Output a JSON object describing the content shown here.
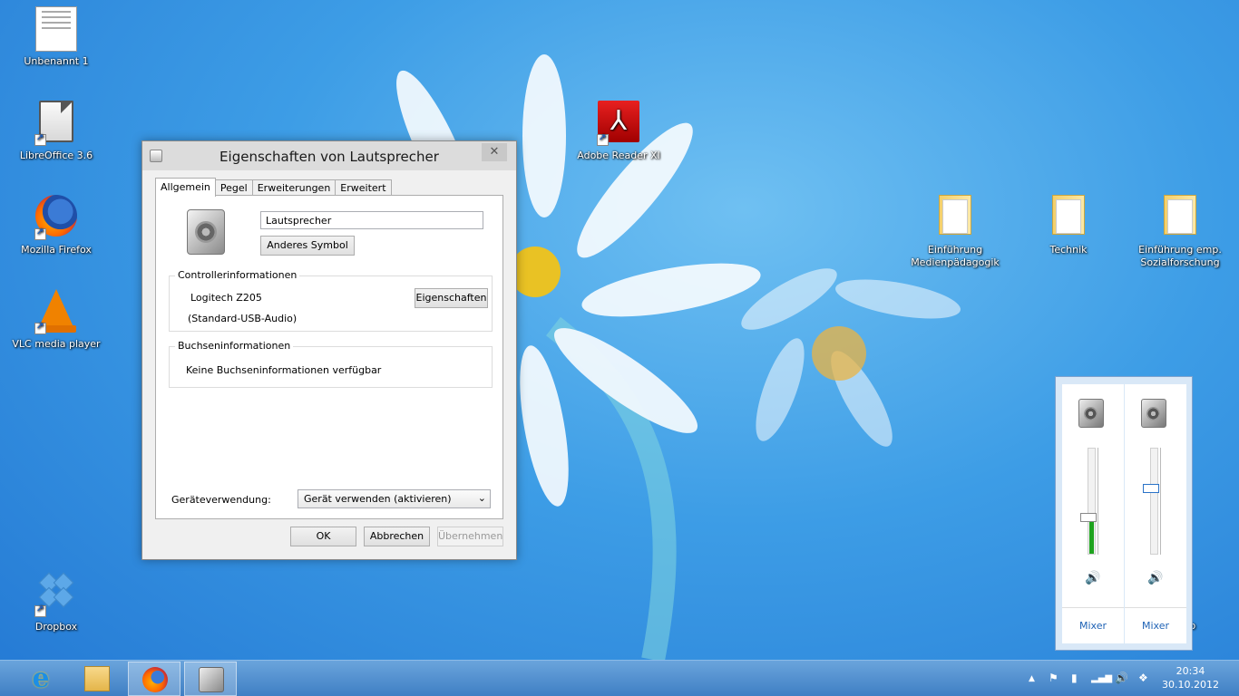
{
  "desktop": {
    "icons": [
      {
        "label": "Unbenannt 1",
        "icon": "document-icon"
      },
      {
        "label": "LibreOffice 3.6",
        "icon": "libreoffice-icon"
      },
      {
        "label": "Mozilla Firefox",
        "icon": "firefox-icon"
      },
      {
        "label": "VLC media player",
        "icon": "vlc-icon"
      },
      {
        "label": "Dropbox",
        "icon": "dropbox-icon"
      },
      {
        "label": "Adobe Reader XI",
        "icon": "adobe-reader-icon"
      },
      {
        "label": "Einführung Medienpädagogik",
        "icon": "folder-icon"
      },
      {
        "label": "Technik",
        "icon": "folder-icon"
      },
      {
        "label": "Einführung emp. Sozialforschung",
        "icon": "folder-icon"
      }
    ],
    "partial_label": "orb"
  },
  "dialog": {
    "title": "Eigenschaften von Lautsprecher",
    "close_glyph": "✕",
    "tabs": [
      "Allgemein",
      "Pegel",
      "Erweiterungen",
      "Erweitert"
    ],
    "active_tab": "Allgemein",
    "device_name": "Lautsprecher",
    "change_icon_button": "Anderes Symbol",
    "controller_group": {
      "legend": "Controllerinformationen",
      "controller_name": "Logitech Z205",
      "driver": "(Standard-USB-Audio)",
      "properties_button": "Eigenschaften"
    },
    "jack_group": {
      "legend": "Buchseninformationen",
      "text": "Keine Buchseninformationen verfügbar"
    },
    "usage_label": "Geräteverwendung:",
    "usage_value": "Gerät verwenden (aktivieren)",
    "ok_button": "OK",
    "cancel_button": "Abbrechen",
    "apply_button": "Übernehmen"
  },
  "volume_flyout": {
    "columns": [
      {
        "level": 0.35,
        "mute_glyph": "🔊",
        "mixer_label": "Mixer"
      },
      {
        "level": 0.62,
        "mute_glyph": "🔊",
        "mixer_label": "Mixer"
      }
    ]
  },
  "taskbar": {
    "apps": [
      "internet-explorer-icon",
      "file-explorer-icon",
      "firefox-icon",
      "speaker-icon"
    ],
    "tray": {
      "show_hidden": "▲",
      "flag": "⚑",
      "power": "▮",
      "network": "▂▄▆",
      "volume": "🔊",
      "dropbox": "❖"
    },
    "time": "20:34",
    "date": "30.10.2012"
  }
}
